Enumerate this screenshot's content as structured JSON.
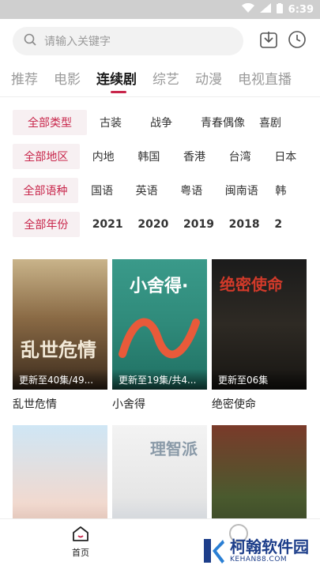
{
  "status_bar": {
    "time": "6:39"
  },
  "search": {
    "placeholder": "请输入关键字"
  },
  "tabs": [
    "推荐",
    "电影",
    "连续剧",
    "综艺",
    "动漫",
    "电视直播"
  ],
  "filters": {
    "type": {
      "all": "全部类型",
      "options": [
        "古装",
        "战争",
        "青春偶像",
        "喜剧"
      ]
    },
    "region": {
      "all": "全部地区",
      "options": [
        "内地",
        "韩国",
        "香港",
        "台湾",
        "日本"
      ]
    },
    "language": {
      "all": "全部语种",
      "options": [
        "国语",
        "英语",
        "粤语",
        "闽南语",
        "韩"
      ]
    },
    "year": {
      "all": "全部年份",
      "options": [
        "2021",
        "2020",
        "2019",
        "2018",
        "2"
      ]
    }
  },
  "shows": [
    {
      "title": "乱世危情",
      "update": "更新至40集/49...",
      "poster_text": "乱世危情"
    },
    {
      "title": "小舍得",
      "update": "更新至19集/共4...",
      "poster_text": "小舍得·"
    },
    {
      "title": "绝密使命",
      "update": "更新至06集",
      "poster_text": "绝密使命"
    },
    {
      "title": "",
      "update": "",
      "poster_text": ""
    },
    {
      "title": "",
      "update": "",
      "poster_text": "理智派"
    },
    {
      "title": "",
      "update": "",
      "poster_text": ""
    }
  ],
  "bottom_nav": {
    "home_label": "首页"
  },
  "watermark": {
    "brand": "柯翰软件园",
    "url": "KEHAN88.COM"
  },
  "colors": {
    "accent": "#c8264b",
    "filter_bg": "#f7f0f2",
    "watermark": "#1d3e8a"
  }
}
